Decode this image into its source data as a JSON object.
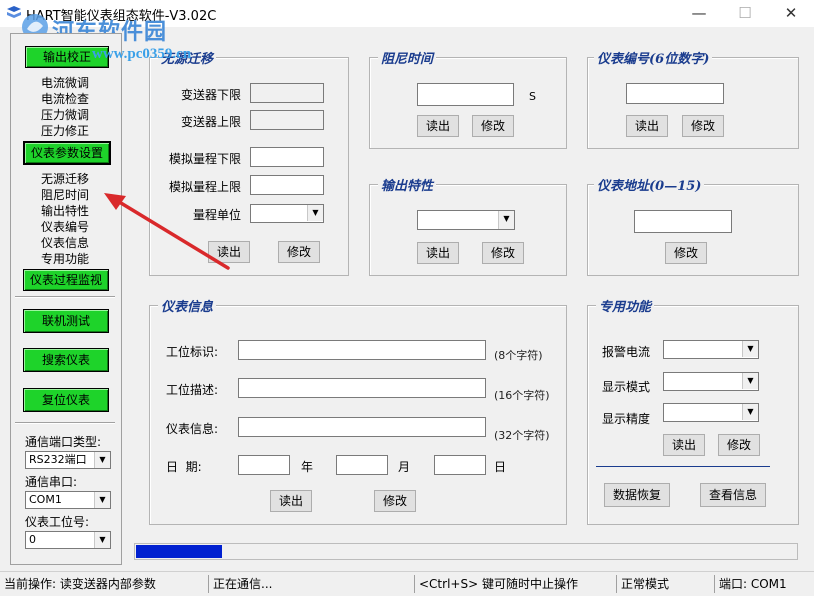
{
  "window": {
    "title": "HART智能仪表组态软件-V3.02C",
    "controls": {
      "minimize": "—",
      "maximize": "☐",
      "close": "✕"
    },
    "watermark": {
      "text": "河东软件园",
      "url": "www.pc0359.cn"
    }
  },
  "sidebar": {
    "btn_output_calib": "输出校正",
    "calib_items": [
      "电流微调",
      "电流检查",
      "压力微调",
      "压力修正"
    ],
    "btn_param_set": "仪表参数设置",
    "param_items": [
      "无源迁移",
      "阻尼时间",
      "输出特性",
      "仪表编号",
      "仪表信息",
      "专用功能"
    ],
    "btn_process_monitor": "仪表过程监视",
    "btn_online_test": "联机测试",
    "btn_search": "搜索仪表",
    "btn_reset": "复位仪表",
    "port_type_label": "通信端口类型:",
    "port_type_value": "RS232端口",
    "serial_label": "通信串口:",
    "serial_value": "COM1",
    "slot_label": "仪表工位号:",
    "slot_value": "0"
  },
  "passive_migration": {
    "title": "无源迁移",
    "sensor_lower": "变送器下限",
    "sensor_upper": "变送器上限",
    "analog_lower": "模拟量程下限",
    "analog_upper": "模拟量程上限",
    "range_unit": "量程单位",
    "read": "读出",
    "modify": "修改"
  },
  "damping": {
    "title": "阻尼时间",
    "unit": "S",
    "read": "读出",
    "modify": "修改"
  },
  "device_no": {
    "title": "仪表编号(6位数字)",
    "read": "读出",
    "modify": "修改"
  },
  "output_char": {
    "title": "输出特性",
    "read": "读出",
    "modify": "修改"
  },
  "device_addr": {
    "title": "仪表地址(0—15)",
    "modify": "修改"
  },
  "device_info": {
    "title": "仪表信息",
    "tag_label": "工位标识:",
    "tag_hint": "(8个字符)",
    "desc_label": "工位描述:",
    "desc_hint": "(16个字符)",
    "info_label": "仪表信息:",
    "info_hint": "(32个字符)",
    "date_label": "日  期:",
    "year": "年",
    "month": "月",
    "day": "日",
    "read": "读出",
    "modify": "修改"
  },
  "special": {
    "title": "专用功能",
    "alarm_current": "报警电流",
    "display_mode": "显示模式",
    "display_precision": "显示精度",
    "read": "读出",
    "modify": "修改",
    "restore": "数据恢复",
    "view_info": "查看信息"
  },
  "progress": {
    "value": 0.13,
    "color": "#0020d0"
  },
  "statusbar": {
    "current_op": "当前操作: 读变送器内部参数",
    "comm": "正在通信...",
    "hint": "<Ctrl+S> 键可随时中止操作",
    "mode": "正常模式",
    "port": "端口: COM1"
  },
  "colors": {
    "green_button": "#1ed32a",
    "group_title": "#1a3c8e",
    "annotation_arrow": "#d9292b"
  }
}
